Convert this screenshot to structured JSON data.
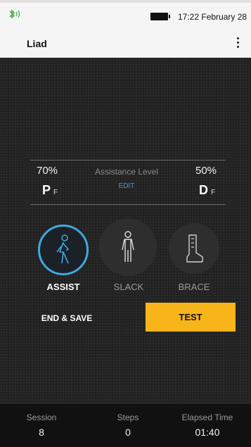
{
  "status_bar": {
    "icon": "bluetooth-icon",
    "battery_icon": "battery-icon",
    "datetime": "17:22 February 28"
  },
  "app_bar": {
    "title": "Liad",
    "menu_icon": "overflow-menu-icon"
  },
  "assistance": {
    "label": "Assistance Level",
    "edit_label": "EDIT",
    "left_percent": "70%",
    "left_letter": "P",
    "left_sub": "F",
    "right_percent": "50%",
    "right_letter": "D",
    "right_sub": "F"
  },
  "modes": [
    {
      "label": "ASSIST",
      "icon": "walking-person-icon",
      "active": true
    },
    {
      "label": "SLACK",
      "icon": "standing-person-icon",
      "active": false
    },
    {
      "label": "BRACE",
      "icon": "boot-brace-icon",
      "active": false
    }
  ],
  "actions": {
    "end_save_label": "END & SAVE",
    "test_label": "TEST"
  },
  "footer": {
    "session_label": "Session",
    "session_value": "8",
    "steps_label": "Steps",
    "steps_value": "0",
    "elapsed_label": "Elapsed Time",
    "elapsed_value": "01:40"
  },
  "colors": {
    "accent_blue": "#3fa8e0",
    "test_button": "#f7b51a",
    "bluetooth": "#4caf50"
  }
}
